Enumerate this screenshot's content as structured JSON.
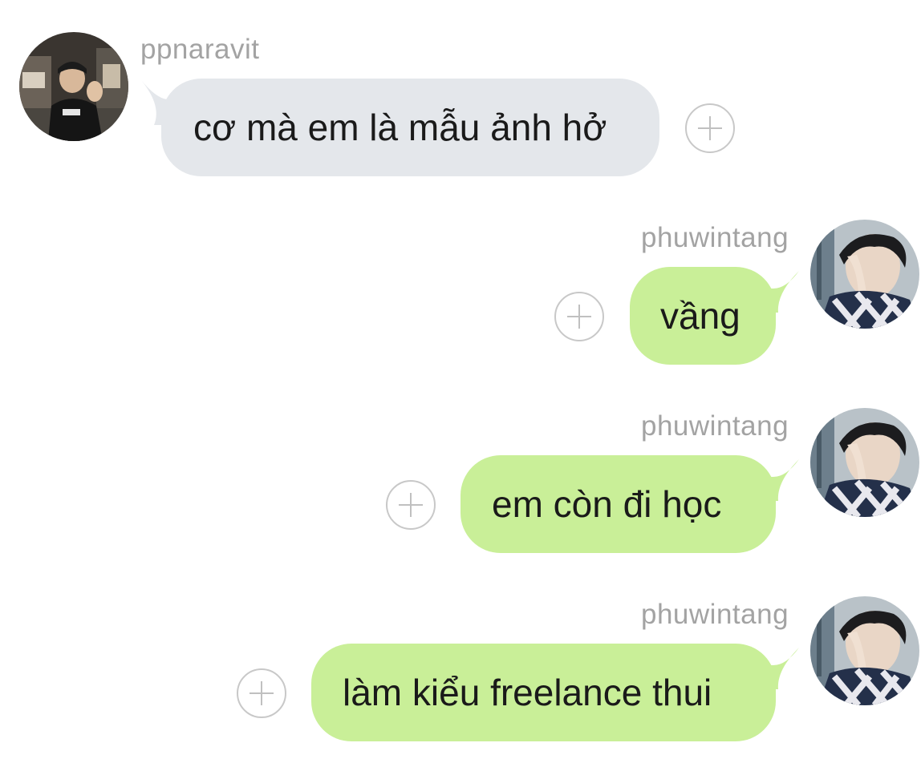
{
  "messages": [
    {
      "sender": "ppnaravit",
      "direction": "incoming",
      "text": "cơ mà em là mẫu ảnh hở"
    },
    {
      "sender": "phuwintang",
      "direction": "outgoing",
      "text": "vầng"
    },
    {
      "sender": "phuwintang",
      "direction": "outgoing",
      "text": "em còn đi học"
    },
    {
      "sender": "phuwintang",
      "direction": "outgoing",
      "text": "làm kiểu freelance thui"
    }
  ],
  "colors": {
    "incoming_bubble": "#e4e7eb",
    "outgoing_bubble": "#c9ef98",
    "username": "#a3a3a3",
    "message_text": "#1a1a1a",
    "plus_icon": "#c0c0c0"
  },
  "icons": {
    "add_reaction": "plus-circle-icon"
  }
}
